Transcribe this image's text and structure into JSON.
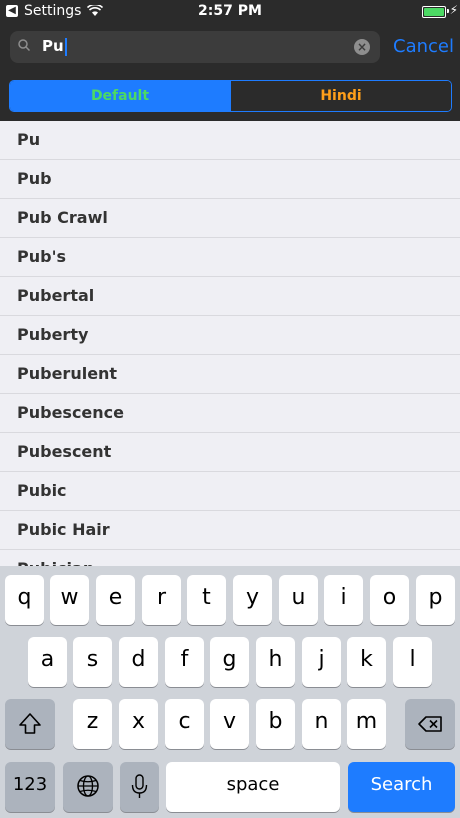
{
  "status_bar": {
    "back_app": "Settings",
    "time": "2:57 PM"
  },
  "search": {
    "query": "Pu",
    "cancel_label": "Cancel"
  },
  "segments": {
    "default": "Default",
    "hindi": "Hindi"
  },
  "results": [
    "Pu",
    "Pub",
    "Pub Crawl",
    "Pub's",
    "Pubertal",
    "Puberty",
    "Puberulent",
    "Pubescence",
    "Pubescent",
    "Pubic",
    "Pubic Hair",
    "Pubician"
  ],
  "keyboard": {
    "row1": [
      "q",
      "w",
      "e",
      "r",
      "t",
      "y",
      "u",
      "i",
      "o",
      "p"
    ],
    "row2": [
      "a",
      "s",
      "d",
      "f",
      "g",
      "h",
      "j",
      "k",
      "l"
    ],
    "row3": [
      "z",
      "x",
      "c",
      "v",
      "b",
      "n",
      "m"
    ],
    "numbers_label": "123",
    "space_label": "space",
    "search_label": "Search"
  },
  "colors": {
    "accent": "#1e7cff",
    "default_text": "#4cd964",
    "hindi_text": "#ff9f1a"
  }
}
